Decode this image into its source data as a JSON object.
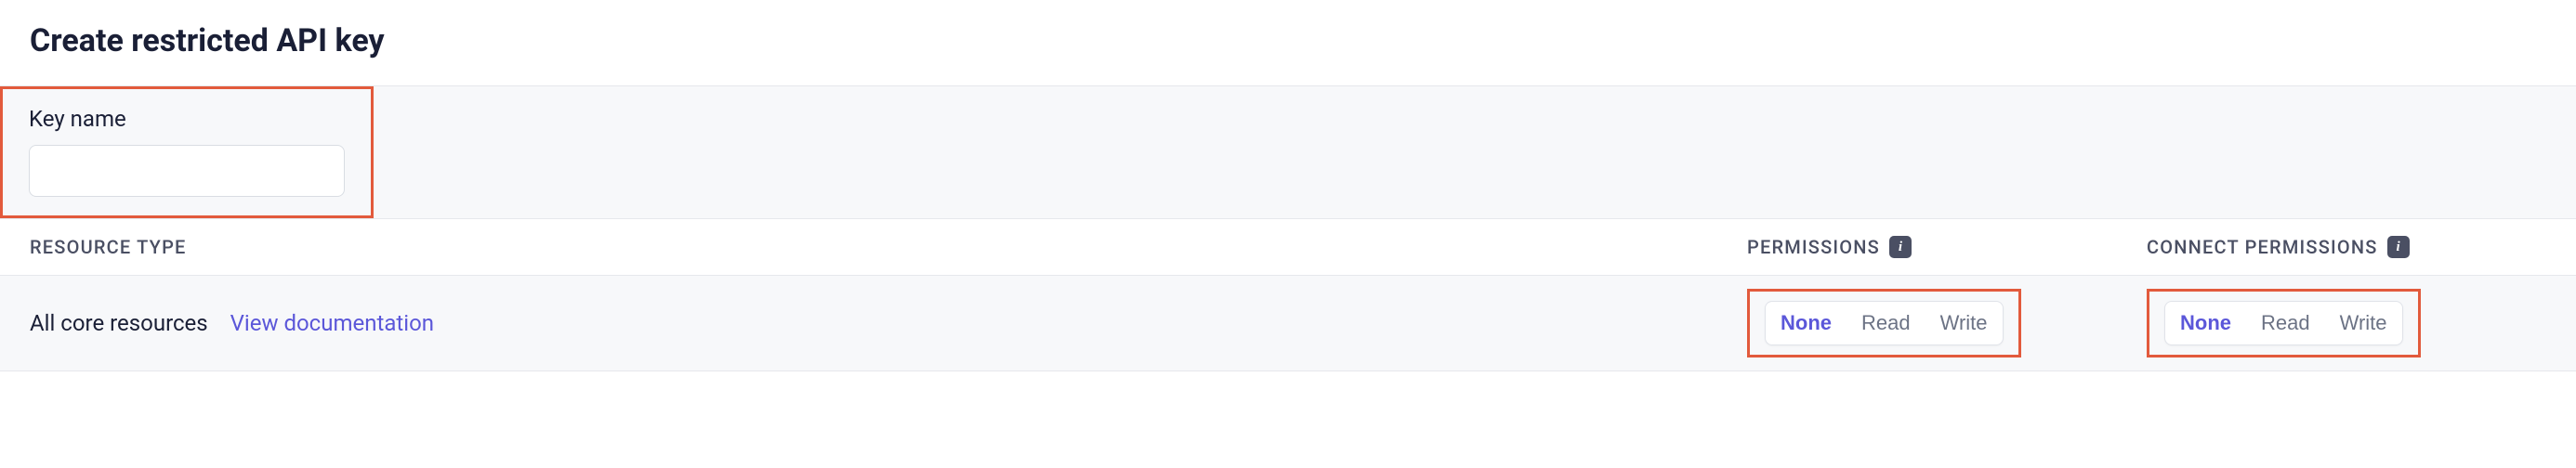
{
  "header": {
    "title": "Create restricted API key"
  },
  "key_name": {
    "label": "Key name",
    "value": ""
  },
  "columns": {
    "resource": "RESOURCE TYPE",
    "permissions": "PERMISSIONS",
    "connect_permissions": "CONNECT PERMISSIONS"
  },
  "row": {
    "resource_name": "All core resources",
    "doc_link_text": "View documentation",
    "permissions": {
      "none": "None",
      "read": "Read",
      "write": "Write",
      "selected": "None"
    },
    "connect_permissions": {
      "none": "None",
      "read": "Read",
      "write": "Write",
      "selected": "None"
    }
  }
}
